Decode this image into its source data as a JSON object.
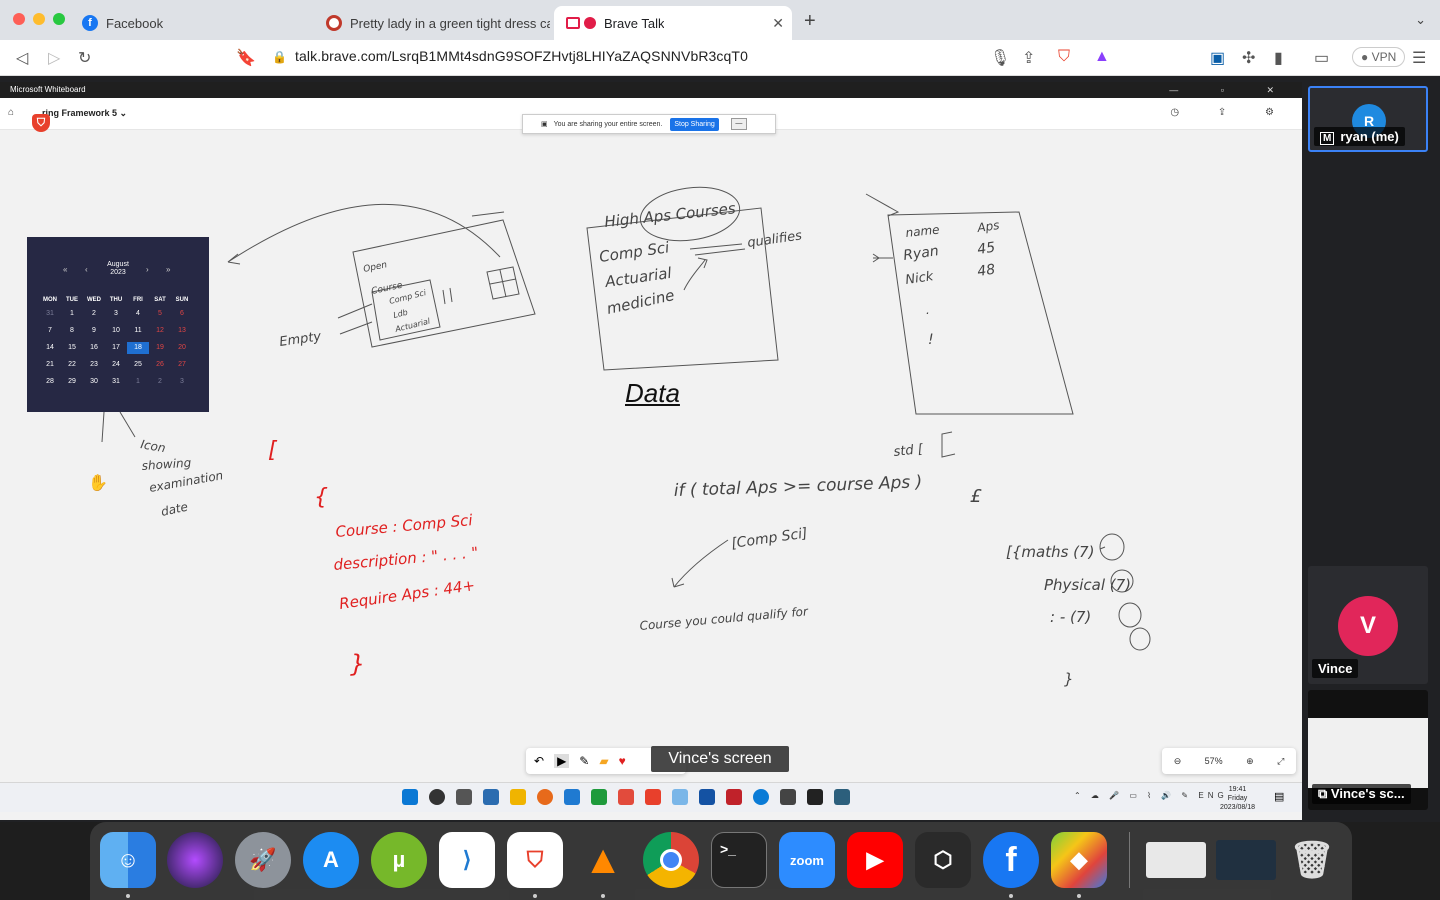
{
  "browser": {
    "tabs": [
      {
        "label": "Facebook",
        "favicon": "facebook-icon",
        "color": "#1877f2"
      },
      {
        "label": "Pretty lady in a green tight dress ca",
        "favicon": "brave-favicon",
        "color": "#c0392b"
      },
      {
        "label": "Brave Talk",
        "favicon": "camera-icon",
        "color": "#e11d48"
      }
    ],
    "url": "talk.brave.com/LsrqB1MMt4sdnG9SOFZHvtj8LHIYaZAQSNNVbR3cqT0",
    "vpn_label": "VPN"
  },
  "whiteboard": {
    "app_title": "Microsoft Whiteboard",
    "board_name": "ring Framework 5",
    "share_notice": "You are sharing your entire screen.",
    "stop_sharing": "Stop Sharing",
    "zoom": "57%",
    "data_label": "Data",
    "calendar": {
      "month": "August",
      "year": "2023",
      "weekdays": [
        "MON",
        "TUE",
        "WED",
        "THU",
        "FRI",
        "SAT",
        "SUN"
      ],
      "days": [
        "31",
        "1",
        "2",
        "3",
        "4",
        "5",
        "6",
        "7",
        "8",
        "9",
        "10",
        "11",
        "12",
        "13",
        "14",
        "15",
        "16",
        "17",
        "18",
        "19",
        "20",
        "21",
        "22",
        "23",
        "24",
        "25",
        "26",
        "27",
        "28",
        "29",
        "30",
        "31",
        "1",
        "2",
        "3"
      ]
    },
    "handwriting": {
      "course_block": [
        "{",
        "Course : Comp Sci",
        "description : \" . . . \"",
        "Require Aps : 44+",
        "}"
      ],
      "bracket": "[",
      "icon_note": [
        "Icon",
        "showing",
        "examination",
        "date"
      ],
      "table_headers": [
        "name",
        "Aps"
      ],
      "table_rows": [
        [
          "Ryan",
          "45"
        ],
        [
          "Nick",
          "48"
        ]
      ],
      "high_aps_title": "High Aps Courses",
      "courses": [
        "Comp Sci",
        "Actuarial",
        "medicine"
      ],
      "qualifies": "qualifies",
      "empty": "Empty",
      "condition": "if ( total Aps >= course Aps )",
      "std": "std [",
      "comp_sci_list": "[Comp Sci]",
      "courses_note": "Course you could qualify for",
      "subjects": [
        "[{maths (7)",
        "Physical (7)",
        ": - (7)",
        "(7)",
        "}"
      ],
      "pen_card": [
        "Open",
        "Course",
        "Comp Sci",
        "Ldb",
        "Actuarial"
      ]
    }
  },
  "overlay": {
    "screen_tag": "Vince's screen"
  },
  "taskbar": {
    "lang": "ENG",
    "time": "19:41",
    "day": "Friday",
    "date": "2023/08/18"
  },
  "participants": [
    {
      "initial": "R",
      "name": "ryan (me)",
      "color": "#1f8ae0"
    },
    {
      "initial": "V",
      "name": "Vince",
      "color": "#e1265a"
    },
    {
      "name": "Vince's sc..."
    }
  ],
  "dock": [
    "Finder",
    "Siri",
    "Launchpad",
    "App Store",
    "uTorrent",
    "VS Code",
    "Brave",
    "VLC",
    "Chrome",
    "Terminal",
    "Zoom",
    "YouTube",
    "Blender",
    "Facebook",
    "BlueStacks"
  ]
}
